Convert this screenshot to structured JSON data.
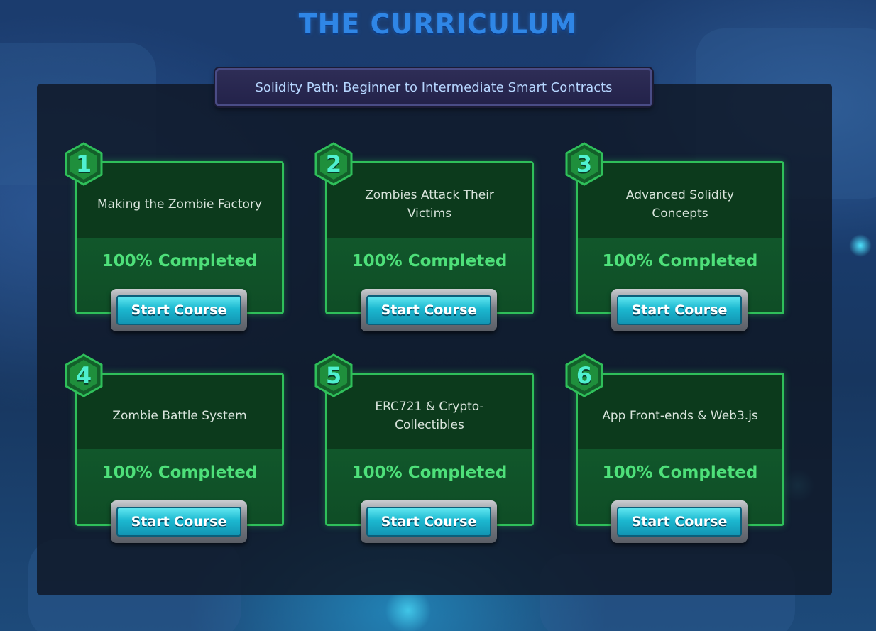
{
  "header": {
    "title": "THE CURRICULUM",
    "path_label": "Solidity Path: Beginner to Intermediate Smart Contracts"
  },
  "courses": [
    {
      "number": "1",
      "title": "Making the Zombie Factory",
      "progress": "100% Completed",
      "button": "Start Course"
    },
    {
      "number": "2",
      "title": "Zombies Attack Their Victims",
      "progress": "100% Completed",
      "button": "Start Course"
    },
    {
      "number": "3",
      "title": "Advanced Solidity Concepts",
      "progress": "100% Completed",
      "button": "Start Course"
    },
    {
      "number": "4",
      "title": "Zombie Battle System",
      "progress": "100% Completed",
      "button": "Start Course"
    },
    {
      "number": "5",
      "title": "ERC721 & Crypto-Collectibles",
      "progress": "100% Completed",
      "button": "Start Course"
    },
    {
      "number": "6",
      "title": "App Front-ends & Web3.js",
      "progress": "100% Completed",
      "button": "Start Course"
    }
  ],
  "colors": {
    "title": "#2f86e6",
    "card_border": "#2fbf5a",
    "progress_text": "#4ee07a",
    "button_face": "#1cb8d0",
    "hex_badge": "#1f8f3c"
  },
  "icons": {
    "badge": "hexagon-number-badge"
  }
}
